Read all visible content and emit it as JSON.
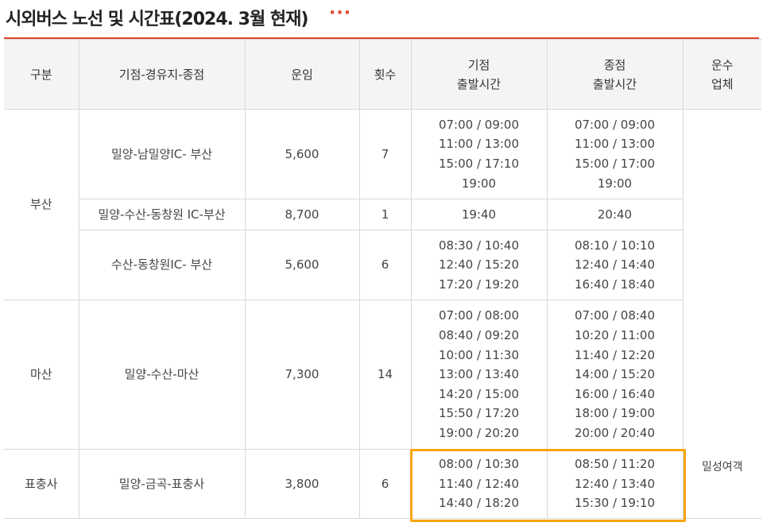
{
  "page": {
    "title": "시외버스 노선 및 시간표(2024. 3월 현재)",
    "more_icon": "···"
  },
  "table": {
    "headers": {
      "category": "구분",
      "route": "기점-경유지-종점",
      "fare": "운임",
      "count": "횟수",
      "origin_departure": "기점\n출발시간",
      "terminus_departure": "종점\n출발시간",
      "operator": "운수\n업체"
    },
    "operator": "밀성여객",
    "groups": [
      {
        "category": "부산"
      },
      {
        "category": "마산"
      },
      {
        "category": "표충사"
      }
    ],
    "rows": [
      {
        "route": "밀양-남밀양IC- 부산",
        "fare": "5,600",
        "count": "7",
        "origin_times": "07:00 / 09:00\n11:00 / 13:00\n15:00 / 17:10\n19:00",
        "terminus_times": "07:00 / 09:00\n11:00 / 13:00\n15:00 / 17:00\n19:00"
      },
      {
        "route": "밀양-수산-동창원 IC-부산",
        "fare": "8,700",
        "count": "1",
        "origin_times": "19:40",
        "terminus_times": "20:40"
      },
      {
        "route": "수산-동창원IC- 부산",
        "fare": "5,600",
        "count": "6",
        "origin_times": "08:30 / 10:40\n12:40 / 15:20\n17:20 / 19:20",
        "terminus_times": "08:10 / 10:10\n12:40 / 14:40\n16:40 / 18:40"
      },
      {
        "route": "밀양-수산-마산",
        "fare": "7,300",
        "count": "14",
        "origin_times": "07:00 / 08:00\n08:40 / 09:20\n10:00 / 11:30\n13:00 / 13:40\n14:20 / 15:00\n15:50 / 17:20\n19:00 / 20:20",
        "terminus_times": "07:00 / 08:40\n10:20 / 11:00\n11:40 / 12:20\n14:00 / 15:20\n16:00 / 16:40\n18:00 / 19:00\n20:00 / 20:40"
      },
      {
        "route": "밀양-금곡-표충사",
        "fare": "3,800",
        "count": "6",
        "origin_times": "08:00 / 10:30\n11:40 / 12:40\n14:40 / 18:20",
        "terminus_times": "08:50 / 11:20\n12:40 / 13:40\n15:30 / 19:10"
      }
    ]
  },
  "colors": {
    "accent": "#e0452d",
    "highlight": "#f7a400",
    "header_bg": "#f4f4f4",
    "border": "#d9d9d9"
  }
}
